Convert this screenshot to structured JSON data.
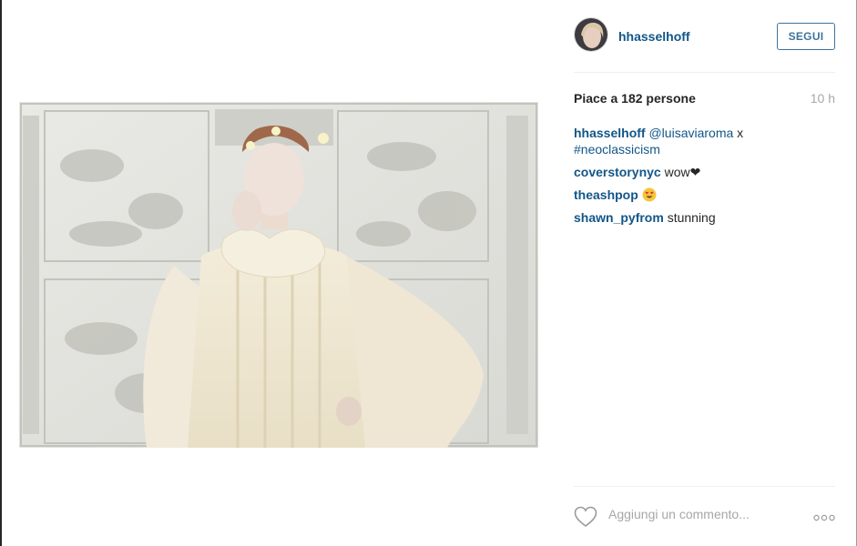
{
  "post": {
    "username": "hhasselhoff",
    "follow_label": "SEGUI",
    "likes_text": "Piace a 182 persone",
    "time_text": "10 h",
    "caption": {
      "user": "hhasselhoff",
      "mention": "@luisaviaroma",
      "connector": " x",
      "hashtag": "#neoclassicism"
    },
    "comments": [
      {
        "user": "coverstorynyc",
        "text": "wow❤"
      },
      {
        "user": "theashpop",
        "emoji": "heart-eyes-emoji"
      },
      {
        "user": "shawn_pyfrom",
        "text": "stunning"
      }
    ],
    "comment_placeholder": "Aggiungi un commento...",
    "icons": [
      "heart-icon",
      "more-options-icon",
      "avatar"
    ]
  },
  "colors": {
    "username_link": "#125688",
    "follow_border": "#3f729b",
    "muted_text": "#a5a7aa",
    "divider": "#efefef"
  }
}
